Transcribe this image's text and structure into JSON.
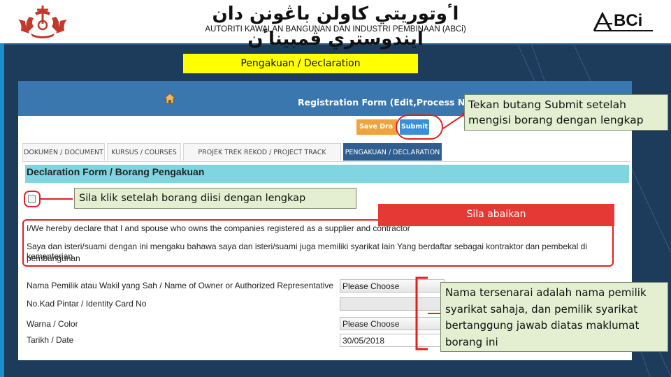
{
  "header": {
    "jawi_title": "اٴوتوريتي كاولن باڠونن دان ايندوستري ڤمبيناٴن",
    "title": "AUTORITI KAWALAN BANGUNAN DAN INDUSTRI PEMBINAAN (ABCi)",
    "logo_text": "BCi"
  },
  "banner": {
    "label": "Pengakuan / Declaration"
  },
  "form": {
    "registration_title": "Registration Form (Edit,Process Name:Id-",
    "save_draft_label": "Save Dra",
    "submit_label": "Submit",
    "tabs": [
      {
        "label": "DOKUMEN / DOCUMENT"
      },
      {
        "label": "KURSUS / COURSES"
      },
      {
        "label": "PROJEK TREK REKOD / PROJECT TRACK RECORD"
      },
      {
        "label": "PENGAKUAN / DECLARATION"
      }
    ],
    "declaration_title": "Declaration Form / Borang Pengakuan",
    "declaration_en": "I/We hereby declare that I and spouse who owns the companies registered as a supplier and contractor",
    "declaration_ms_1": "Saya dan isteri/suami dengan ini mengaku bahawa saya dan isteri/suami juga memiliki syarikat lain Yang berdaftar sebagai kontraktor dan pembekal di kementerian",
    "declaration_ms_2": "pembangunan",
    "fields": {
      "owner_label": "Nama Pemilik atau Wakil yang Sah / Name of Owner or Authorized Representative",
      "owner_value": "Please Choose",
      "ic_label": "No.Kad Pintar / Identity Card No",
      "ic_value": "",
      "color_label": "Warna / Color",
      "color_value": "Please Choose",
      "date_label": "Tarikh / Date",
      "date_value": "30/05/2018"
    }
  },
  "annotations": {
    "submit_note": "Tekan butang Submit setelah mengisi borang dengan lengkap",
    "checkbox_note": "Sila klik setelah borang diisi dengan lengkap",
    "ignore_label": "Sila abaikan",
    "owner_note": "Nama tersenarai adalah nama pemilik syarikat sahaja, dan pemilik syarikat bertanggung jawab diatas maklumat borang ini"
  },
  "colors": {
    "background": "#1d3b5a",
    "banner": "#ffff00",
    "form_header": "#3a77ae",
    "declaration_bar": "#7fd5e0",
    "callout": "#e4efd2",
    "highlight": "#e02020"
  }
}
